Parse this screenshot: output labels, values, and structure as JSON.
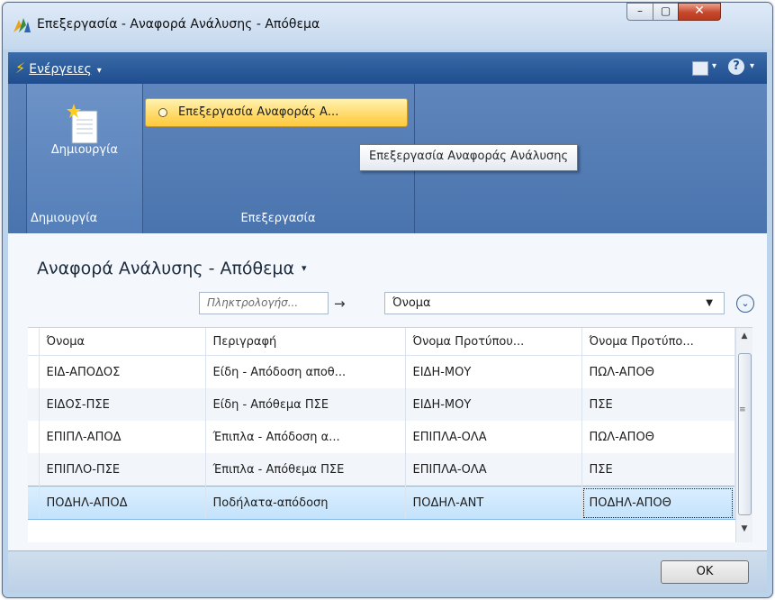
{
  "window": {
    "title": "Επεξεργασία - Αναφορά Ανάλυσης - Απόθεμα",
    "min_glyph": "–",
    "max_glyph": "▢",
    "close_glyph": "✕"
  },
  "commandbar": {
    "actions_label": "Ενέργειες",
    "actions_arrow": "▾",
    "help_glyph": "?",
    "dropdown_arrow": "▾"
  },
  "ribbon": {
    "groups": [
      {
        "label": "Δημιουργία",
        "button_label": "Δημιουργία"
      },
      {
        "label": "Επεξεργασία",
        "button_label": "Επεξεργασία Αναφοράς Α..."
      }
    ],
    "tooltip": "Επεξεργασία Αναφοράς Ανάλυσης"
  },
  "content": {
    "page_title": "Αναφορά Ανάλυσης - Απόθεμα",
    "title_arrow": "▾",
    "filter": {
      "placeholder": "Πληκτρολογήσ...",
      "arrow": "→",
      "field_value": "Όνομα",
      "caret": "▼",
      "expand_glyph": "⌄"
    },
    "grid": {
      "columns": [
        "Όνομα",
        "Περιγραφή",
        "Όνομα Προτύπου...",
        "Όνομα Προτύπο..."
      ],
      "rows": [
        [
          "ΕΙΔ-ΑΠΟΔΟΣ",
          "Είδη - Απόδοση αποθ...",
          "ΕΙΔΗ-ΜΟΥ",
          "ΠΩΛ-ΑΠΟΘ"
        ],
        [
          "ΕΙΔΟΣ-ΠΣΕ",
          "Είδη - Απόθεμα ΠΣΕ",
          "ΕΙΔΗ-ΜΟΥ",
          "ΠΣΕ"
        ],
        [
          "ΕΠΙΠΛ-ΑΠΟΔ",
          "Έπιπλα - Απόδοση α...",
          "ΕΠΙΠΛΑ-ΟΛΑ",
          "ΠΩΛ-ΑΠΟΘ"
        ],
        [
          "ΕΠΙΠΛΟ-ΠΣΕ",
          "Έπιπλα - Απόθεμα ΠΣΕ",
          "ΕΠΙΠΛΑ-ΟΛΑ",
          "ΠΣΕ"
        ],
        [
          "ΠΟΔΗΛ-ΑΠΟΔ",
          "Ποδήλατα-απόδοση",
          "ΠΟΔΗΛ-ΑΝΤ",
          "ΠΟΔΗΛ-ΑΠΟΘ"
        ]
      ],
      "selected_row": 4,
      "scroll_up": "▲",
      "scroll_down": "▼",
      "scroll_grip": "≡"
    }
  },
  "footer": {
    "ok_label": "OK"
  },
  "colors": {
    "ribbon": "#4a74ae",
    "commandbar": "#1f4d8f",
    "highlight_button": "#ffd867",
    "selected_row": "#c2e2fc"
  }
}
